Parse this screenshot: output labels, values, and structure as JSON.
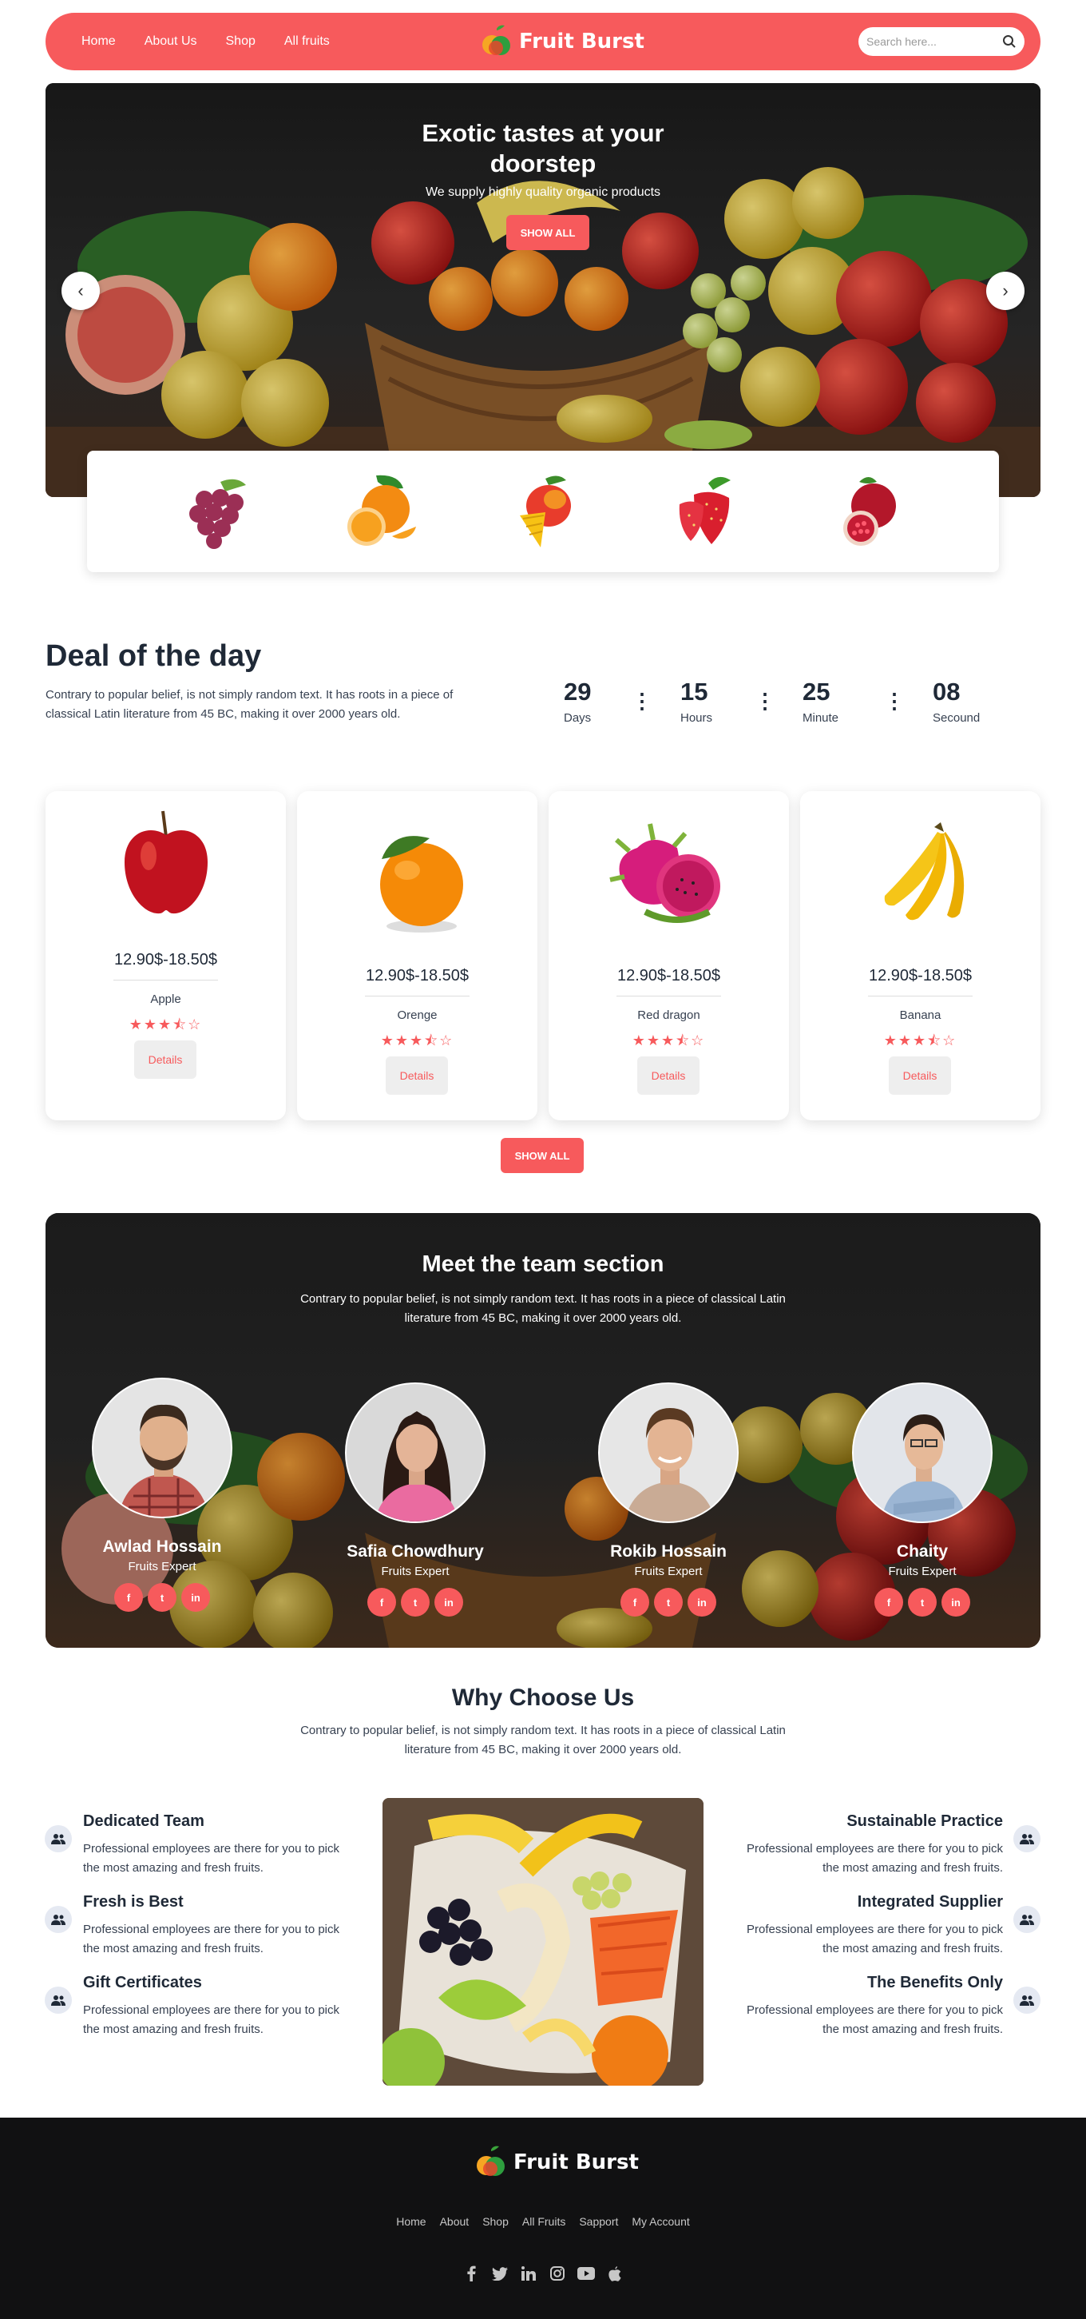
{
  "nav": {
    "links": [
      "Home",
      "About Us",
      "Shop",
      "All fruits"
    ],
    "brand": "Fruit Burst",
    "search_placeholder": "Search here..."
  },
  "colors": {
    "accent": "#f75a5c",
    "dark": "#1f2937",
    "footer": "#111112"
  },
  "hero": {
    "title": "Exotic tastes at your doorstep",
    "subtitle": "We supply highly quality organic products",
    "button": "SHOW ALL"
  },
  "strip": {
    "icons": [
      "grapes-icon",
      "orange-icon",
      "mango-icon",
      "strawberry-icon",
      "pomegranate-icon"
    ]
  },
  "deal": {
    "title": "Deal of the day",
    "text": "Contrary to popular belief, is not simply random text. It has roots in a piece of classical Latin literature from 45 BC, making it over 2000 years old.",
    "countdown": [
      {
        "value": "29",
        "label": "Days"
      },
      {
        "value": "15",
        "label": "Hours"
      },
      {
        "value": "25",
        "label": "Minute"
      },
      {
        "value": "08",
        "label": "Secound"
      }
    ]
  },
  "products": [
    {
      "price": "12.90$-18.50$",
      "name": "Apple",
      "rating": 3.5,
      "button": "Details"
    },
    {
      "price": "12.90$-18.50$",
      "name": "Orenge",
      "rating": 3.5,
      "button": "Details"
    },
    {
      "price": "12.90$-18.50$",
      "name": "Red dragon",
      "rating": 3.5,
      "button": "Details"
    },
    {
      "price": "12.90$-18.50$",
      "name": "Banana",
      "rating": 3.5,
      "button": "Details"
    }
  ],
  "products_button": "SHOW ALL",
  "team": {
    "title": "Meet the team section",
    "text": "Contrary to popular belief, is not simply random text. It has roots in a piece of classical Latin literature from 45 BC, making it over 2000 years old.",
    "members": [
      {
        "name": "Awlad Hossain",
        "role": "Fruits Expert"
      },
      {
        "name": "Safia Chowdhury",
        "role": "Fruits Expert"
      },
      {
        "name": "Rokib Hossain",
        "role": "Fruits Expert"
      },
      {
        "name": "Chaity",
        "role": "Fruits Expert"
      }
    ],
    "socials": [
      "f",
      "t",
      "in"
    ]
  },
  "why": {
    "title": "Why Choose Us",
    "text": "Contrary to popular belief, is not simply random text. It has roots in a piece of classical Latin literature from 45 BC, making it over 2000 years old.",
    "left": [
      {
        "title": "Dedicated Team",
        "text": "Professional employees are there for you to pick the most amazing and fresh fruits."
      },
      {
        "title": "Fresh is Best",
        "text": "Professional employees are there for you to pick the most amazing and fresh fruits."
      },
      {
        "title": "Gift Certificates",
        "text": "Professional employees are there for you to pick the most amazing and fresh fruits."
      }
    ],
    "right": [
      {
        "title": "Sustainable Practice",
        "text": "Professional employees are there for you to pick the most amazing and fresh fruits."
      },
      {
        "title": "Integrated Supplier",
        "text": "Professional employees are there for you to pick the most amazing and fresh fruits."
      },
      {
        "title": "The Benefits Only",
        "text": "Professional employees are there for you to pick the most amazing and fresh fruits."
      }
    ]
  },
  "footer": {
    "brand": "Fruit Burst",
    "links": [
      "Home",
      "About",
      "Shop",
      "All Fruits",
      "Sapport",
      "My Account"
    ],
    "socials": [
      "facebook-icon",
      "twitter-icon",
      "linkedin-icon",
      "instagram-icon",
      "youtube-icon",
      "apple-icon"
    ]
  }
}
